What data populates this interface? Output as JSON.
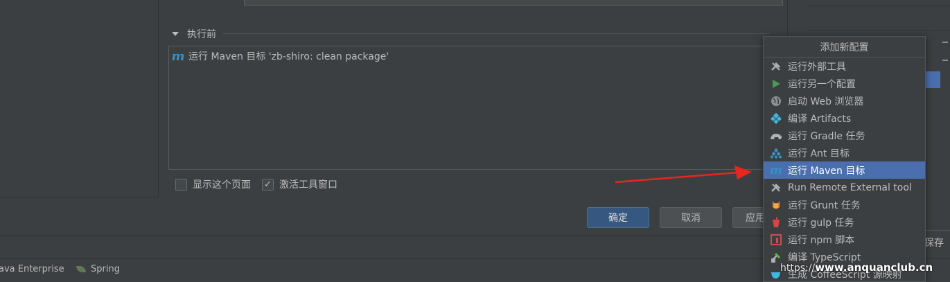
{
  "before_launch": {
    "header": "执行前",
    "tasks": [
      {
        "icon": "maven-icon",
        "label": "运行 Maven 目标 'zb-shiro: clean package'"
      }
    ]
  },
  "options": {
    "show_page": {
      "label": "显示这个页面",
      "checked": false
    },
    "activate_tool_window": {
      "label": "激活工具窗口",
      "checked": true
    }
  },
  "buttons": {
    "ok": "确定",
    "cancel": "取消",
    "apply": "应用"
  },
  "popup": {
    "title": "添加新配置",
    "items": [
      {
        "icon": "tools-icon",
        "label": "运行外部工具"
      },
      {
        "icon": "run-icon",
        "label": "运行另一个配置"
      },
      {
        "icon": "globe-icon",
        "label": "启动 Web 浏览器"
      },
      {
        "icon": "artifact-icon",
        "label": "编译 Artifacts"
      },
      {
        "icon": "gradle-icon",
        "label": "运行 Gradle 任务"
      },
      {
        "icon": "ant-icon",
        "label": "运行 Ant 目标"
      },
      {
        "icon": "maven-icon",
        "label": "运行 Maven 目标",
        "selected": true
      },
      {
        "icon": "tools-icon",
        "label": "Run Remote External tool"
      },
      {
        "icon": "grunt-icon",
        "label": "运行 Grunt 任务"
      },
      {
        "icon": "gulp-icon",
        "label": "运行 gulp 任务"
      },
      {
        "icon": "npm-icon",
        "label": "运行 npm 脚本"
      },
      {
        "icon": "typescript-icon",
        "label": "编译 TypeScript"
      },
      {
        "icon": "coffeescript-icon",
        "label": "生成 CoffeeScript 源映射"
      }
    ]
  },
  "bottom_tabs": {
    "java_enterprise": "ava Enterprise",
    "spring": "Spring"
  },
  "right_panel": {
    "save_fragment": "保存"
  },
  "watermark": {
    "prefix": "https://",
    "domain": "www.anquanclub.cn"
  },
  "colors": {
    "background": "#3c3f41",
    "selection": "#4b6eaf",
    "ok_button": "#365880",
    "arrow": "#e8261f"
  }
}
